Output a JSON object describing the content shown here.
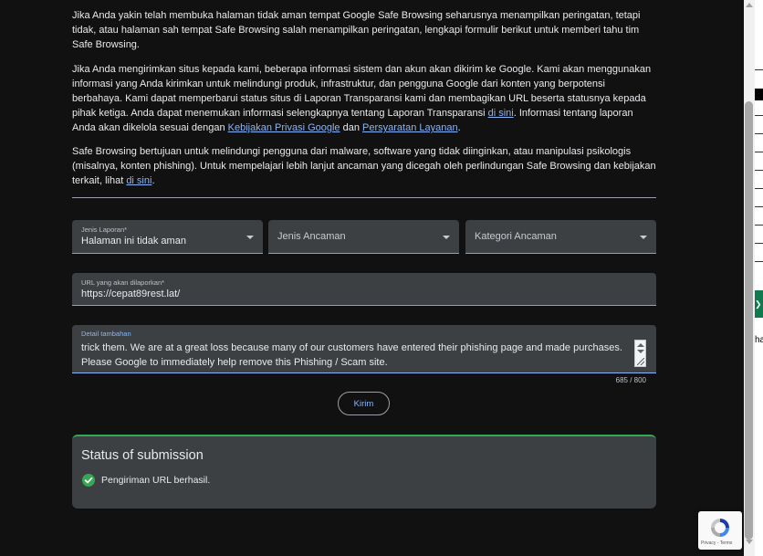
{
  "intro": {
    "p1": "Jika Anda yakin telah membuka halaman tidak aman tempat Google Safe Browsing seharusnya menampilkan peringatan, tetapi tidak, atau halaman sah tempat Safe Browsing salah menampilkan peringatan, lengkapi formulir berikut untuk memberi tahu tim Safe Browsing.",
    "p2_a": "Jika Anda mengirimkan situs kepada kami, beberapa informasi sistem dan akun akan dikirim ke Google. Kami akan menggunakan informasi yang Anda kirimkan untuk melindungi produk, infrastruktur, dan pengguna Google dari konten yang berpotensi berbahaya. Kami dapat memperbarui status situs di Laporan Transparansi kami dan membagikan URL beserta statusnya kepada pihak ketiga. Anda dapat menemukan informasi selengkapnya tentang Laporan Transparansi ",
    "p2_link1": "di sini",
    "p2_b": ". Informasi tentang laporan Anda akan dikelola sesuai dengan ",
    "p2_link2": "Kebijakan Privasi Google",
    "p2_c": " dan ",
    "p2_link3": "Persyaratan Layanan",
    "p2_d": ".",
    "p3_a": "Safe Browsing bertujuan untuk melindungi pengguna dari malware, software yang tidak diinginkan, atau manipulasi psikologis (misalnya, konten phishing). Untuk mempelajari lebih lanjut ancaman yang dicegah oleh perlindungan Safe Browsing dan kebijakan terkait, lihat ",
    "p3_link": "di sini",
    "p3_b": "."
  },
  "form": {
    "report_type": {
      "label": "Jenis Laporan*",
      "value": "Halaman ini tidak aman"
    },
    "threat_type": {
      "placeholder": "Jenis Ancaman"
    },
    "threat_category": {
      "placeholder": "Kategori Ancaman"
    },
    "url": {
      "label": "URL yang akan dilaporkan*",
      "value": "https://cepat89rest.lat/"
    },
    "details": {
      "label": "Detail tambahan",
      "line1": "trick them. We are at a great loss because many of our customers have entered their phishing page and made purchases.",
      "line2": "Please Google to immediately help remove this Phishing / Scam site.",
      "counter": "685 / 800"
    },
    "submit_label": "Kirim"
  },
  "status": {
    "title": "Status of submission",
    "message": "Pengiriman URL berhasil."
  },
  "background_strip": {
    "text": "ha",
    "green_glyph": "❯"
  },
  "recaptcha": {
    "privacy": "Privacy",
    "separator": " - ",
    "terms": "Terms"
  },
  "colors": {
    "background": "#111111",
    "field": "#3c4043",
    "link": "#8ab4f8",
    "success": "#34a853"
  },
  "icons": [
    "check-circle-icon",
    "dropdown-caret-icon",
    "recaptcha-logo-icon"
  ]
}
